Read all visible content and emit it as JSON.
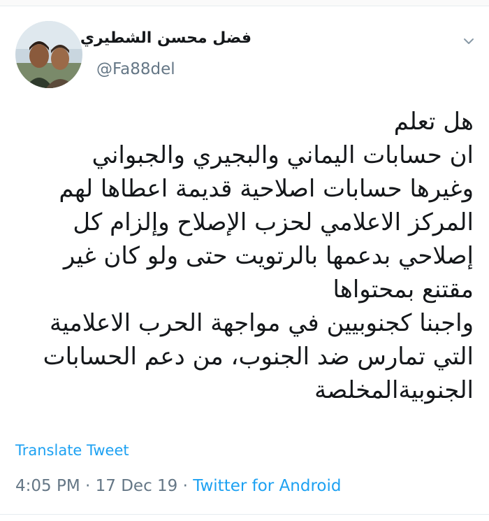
{
  "tweet": {
    "author_name": "فضل محسن الشطيري",
    "author_handle": "@Fa88del",
    "lines": [
      "هل تعلم",
      "ان حسابات اليماني والبجيري والجبواني",
      "وغيرها حسابات اصلاحية قديمة اعطاها لهم",
      "المركز الاعلامي لحزب الإصلاح وإلزام كل",
      "إصلاحي بدعمها بالرتويت حتى ولو كان غير",
      "مقتنع بمحتواها",
      "واجبنا كجنوبيين في مواجهة الحرب الاعلامية",
      "التي تمارس ضد الجنوب، من دعم الحسابات",
      "الجنوبيةالمخلصة"
    ],
    "translate_label": "Translate Tweet",
    "time": "4:05 PM",
    "separator": "·",
    "date": "17 Dec 19",
    "source": "Twitter for Android"
  },
  "icons": {
    "menu": "chevron-down-icon",
    "avatar": "profile-photo"
  },
  "colors": {
    "link": "#1da1f2",
    "secondary_text": "#657786",
    "primary_text": "#14171a",
    "divider": "#e6ecf0"
  }
}
